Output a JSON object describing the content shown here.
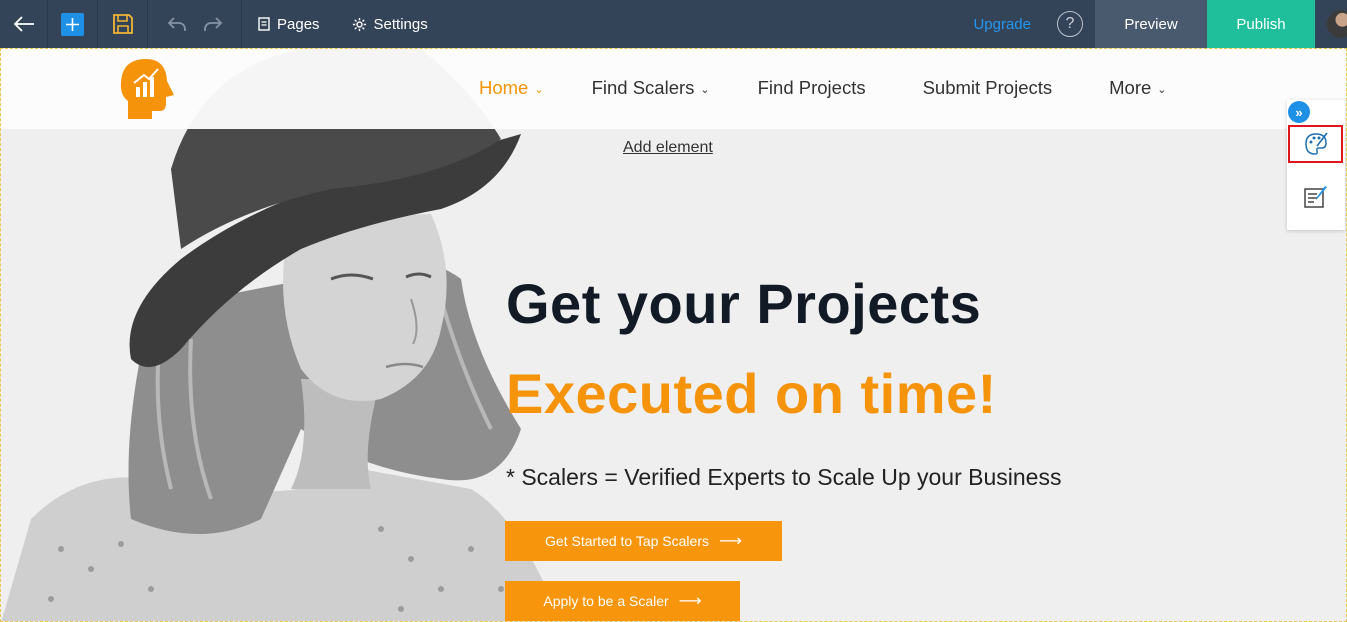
{
  "toolbar": {
    "pages_label": "Pages",
    "settings_label": "Settings",
    "upgrade_label": "Upgrade",
    "help_label": "?",
    "preview_label": "Preview",
    "publish_label": "Publish"
  },
  "site": {
    "nav": [
      {
        "label": "Home",
        "has_dropdown": true,
        "active": true
      },
      {
        "label": "Find Scalers",
        "has_dropdown": true,
        "active": false
      },
      {
        "label": "Find Projects",
        "has_dropdown": false,
        "active": false
      },
      {
        "label": "Submit Projects",
        "has_dropdown": false,
        "active": false
      },
      {
        "label": "More",
        "has_dropdown": true,
        "active": false
      }
    ],
    "add_element": "Add element",
    "hero": {
      "headline": "Get your Projects",
      "headline_accent": "Executed on time!",
      "tagline": "* Scalers = Verified Experts to Scale Up your Business",
      "cta_primary": "Get Started to Tap Scalers",
      "cta_secondary": "Apply to be a Scaler"
    }
  },
  "colors": {
    "toolbar_bg": "#344458",
    "accent_orange": "#f5930a",
    "publish_green": "#1fbf9b",
    "link_blue": "#2596f0",
    "highlight_red": "#e0161e"
  },
  "icons": [
    "back-arrow-icon",
    "plus-icon",
    "save-icon",
    "undo-icon",
    "redo-icon",
    "page-icon",
    "gear-icon",
    "help-icon",
    "chevron-down-icon",
    "arrow-right-icon",
    "expand-icon",
    "palette-icon",
    "edit-note-icon"
  ]
}
